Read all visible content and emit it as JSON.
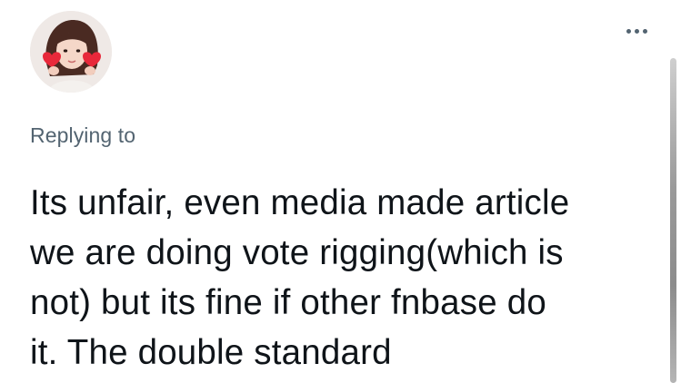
{
  "tweet": {
    "replying_label": "Replying to",
    "text_lines": [
      "Its unfair, even media made article",
      "we are doing vote rigging(which is",
      "not) but its fine if other fnbase do",
      "it. The double standard"
    ]
  },
  "icons": {
    "avatar": "user-avatar",
    "more": "more-options-icon"
  },
  "colors": {
    "text_primary": "#0f1419",
    "text_secondary": "#536471",
    "background": "#ffffff"
  }
}
